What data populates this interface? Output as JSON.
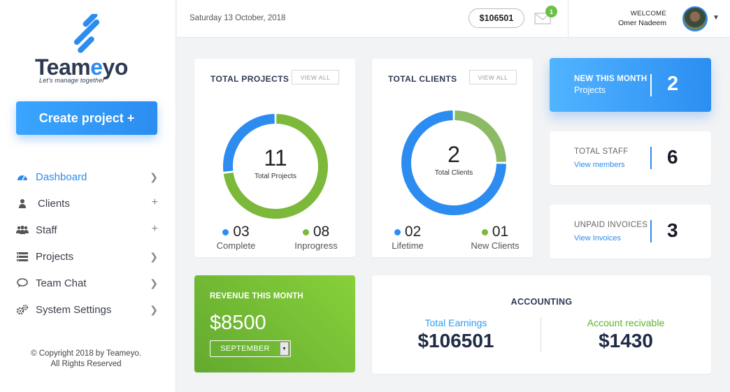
{
  "brand": {
    "name_prefix": "Team",
    "name_accent": "e",
    "name_suffix": "yo",
    "tagline": "Let's manage together",
    "accent_color": "#2d8cf0"
  },
  "sidebar": {
    "create_button": "Create project +",
    "items": [
      {
        "label": "Dashboard",
        "icon": "dashboard-icon",
        "indicator": "chevron",
        "active": true
      },
      {
        "label": "Clients",
        "icon": "user-icon",
        "indicator": "plus",
        "active": false
      },
      {
        "label": "Staff",
        "icon": "users-icon",
        "indicator": "plus",
        "active": false
      },
      {
        "label": "Projects",
        "icon": "projects-icon",
        "indicator": "chevron",
        "active": false
      },
      {
        "label": "Team Chat",
        "icon": "chat-icon",
        "indicator": "chevron",
        "active": false
      },
      {
        "label": "System Settings",
        "icon": "gears-icon",
        "indicator": "chevron",
        "active": false
      }
    ],
    "copyright_line1": "© Copyright 2018 by Teameyo.",
    "copyright_line2": "All Rights Reserved"
  },
  "header": {
    "date": "Saturday 13 October, 2018",
    "balance": "$106501",
    "mail_badge": "1",
    "welcome": "WELCOME",
    "username": "Omer Nadeem"
  },
  "projects": {
    "title": "TOTAL PROJECTS",
    "view_all": "VIEW ALL",
    "total": "11",
    "total_label": "Total Projects",
    "complete_value": "03",
    "complete_label": "Complete",
    "inprogress_value": "08",
    "inprogress_label": "Inprogress",
    "complete_fraction": 0.27,
    "colors": {
      "complete": "#2d8cf0",
      "inprogress": "#7cb83a"
    }
  },
  "clients": {
    "title": "TOTAL CLIENTS",
    "view_all": "VIEW ALL",
    "total": "2",
    "total_label": "Total Clients",
    "lifetime_value": "02",
    "lifetime_label": "Lifetime",
    "new_value": "01",
    "new_label": "New Clients",
    "new_fraction": 0.25,
    "colors": {
      "lifetime": "#2d8cf0",
      "new": "#8dba65"
    }
  },
  "new_this_month": {
    "title": "NEW THIS MONTH",
    "subtitle": "Projects",
    "value": "2"
  },
  "total_staff": {
    "title": "TOTAL STAFF",
    "link": "View members",
    "value": "6"
  },
  "unpaid_invoices": {
    "title": "UNPAID INVOICES",
    "link": "View Invoices",
    "value": "3"
  },
  "revenue": {
    "title": "REVENUE THIS MONTH",
    "amount": "$8500",
    "month": "SEPTEMBER"
  },
  "accounting": {
    "title": "ACCOUNTING",
    "earnings_label": "Total Earnings",
    "earnings_value": "$106501",
    "receivable_label": "Account recivable",
    "receivable_value": "$1430",
    "earnings_color": "#2d9cf0",
    "receivable_color": "#5ab52a"
  }
}
